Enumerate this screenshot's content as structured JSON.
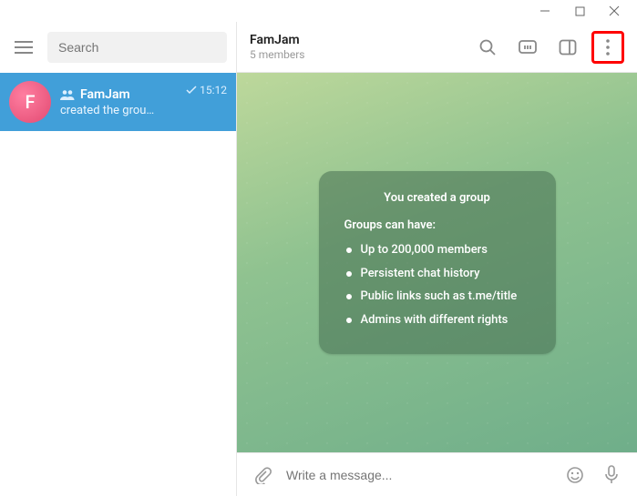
{
  "search": {
    "placeholder": "Search"
  },
  "chat_list": {
    "items": [
      {
        "avatar_letter": "F",
        "title": "FamJam",
        "time": "15:12",
        "preview": "created the grou…"
      }
    ]
  },
  "header": {
    "title": "FamJam",
    "subtitle": "5 members"
  },
  "group_card": {
    "title": "You created a group",
    "subtitle": "Groups can have:",
    "bullets": [
      "Up to 200,000 members",
      "Persistent chat history",
      "Public links such as t.me/title",
      "Admins with different rights"
    ]
  },
  "composer": {
    "placeholder": "Write a message..."
  }
}
